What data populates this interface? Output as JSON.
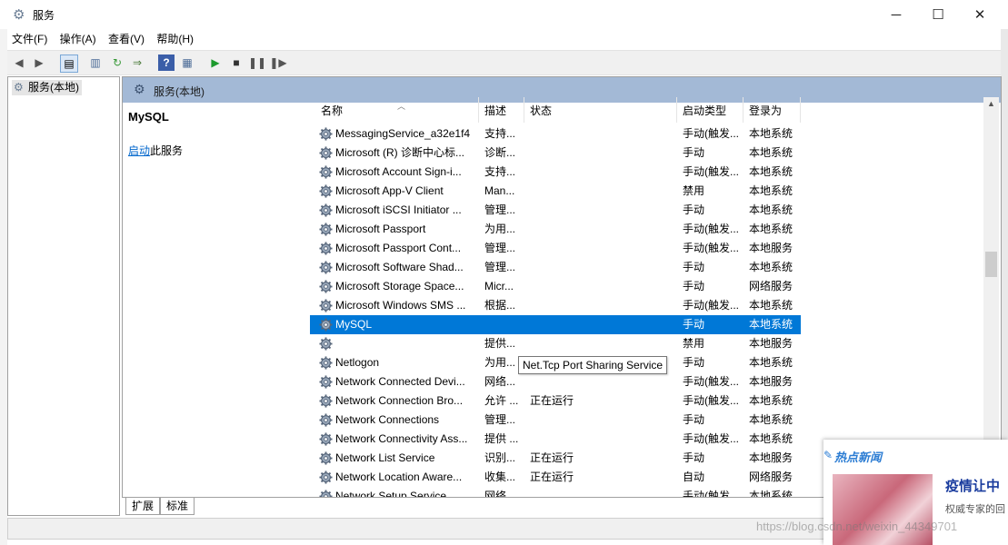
{
  "window": {
    "title": "服务",
    "controls": {
      "minimize": "─",
      "maximize": "☐",
      "close": "✕"
    }
  },
  "menu": [
    "文件(F)",
    "操作(A)",
    "查看(V)",
    "帮助(H)"
  ],
  "tree": {
    "item": "服务(本地)"
  },
  "pane": {
    "header": "服务(本地)"
  },
  "detail": {
    "service_name": "MySQL",
    "start_link": "启动",
    "start_suffix": "此服务"
  },
  "columns": {
    "name": "名称",
    "desc": "描述",
    "status": "状态",
    "start_type": "启动类型",
    "logon": "登录为"
  },
  "rows": [
    {
      "name": "MessagingService_a32e1f4",
      "desc": "支持...",
      "status": "",
      "start": "手动(触发...",
      "logon": "本地系统"
    },
    {
      "name": "Microsoft (R) 诊断中心标...",
      "desc": "诊断...",
      "status": "",
      "start": "手动",
      "logon": "本地系统"
    },
    {
      "name": "Microsoft Account Sign-i...",
      "desc": "支持...",
      "status": "",
      "start": "手动(触发...",
      "logon": "本地系统"
    },
    {
      "name": "Microsoft App-V Client",
      "desc": "Man...",
      "status": "",
      "start": "禁用",
      "logon": "本地系统"
    },
    {
      "name": "Microsoft iSCSI Initiator ...",
      "desc": "管理...",
      "status": "",
      "start": "手动",
      "logon": "本地系统"
    },
    {
      "name": "Microsoft Passport",
      "desc": "为用...",
      "status": "",
      "start": "手动(触发...",
      "logon": "本地系统"
    },
    {
      "name": "Microsoft Passport Cont...",
      "desc": "管理...",
      "status": "",
      "start": "手动(触发...",
      "logon": "本地服务"
    },
    {
      "name": "Microsoft Software Shad...",
      "desc": "管理...",
      "status": "",
      "start": "手动",
      "logon": "本地系统"
    },
    {
      "name": "Microsoft Storage Space...",
      "desc": "Micr...",
      "status": "",
      "start": "手动",
      "logon": "网络服务"
    },
    {
      "name": "Microsoft Windows SMS ...",
      "desc": "根据...",
      "status": "",
      "start": "手动(触发...",
      "logon": "本地系统"
    },
    {
      "name": "MySQL",
      "desc": "",
      "status": "",
      "start": "手动",
      "logon": "本地系统",
      "selected": true
    },
    {
      "name": "",
      "desc": "提供...",
      "status": "",
      "start": "禁用",
      "logon": "本地服务"
    },
    {
      "name": "Netlogon",
      "desc": "为用...",
      "status": "",
      "start": "手动",
      "logon": "本地系统"
    },
    {
      "name": "Network Connected Devi...",
      "desc": "网络...",
      "status": "",
      "start": "手动(触发...",
      "logon": "本地服务"
    },
    {
      "name": "Network Connection Bro...",
      "desc": "允许 ...",
      "status": "正在运行",
      "start": "手动(触发...",
      "logon": "本地系统"
    },
    {
      "name": "Network Connections",
      "desc": "管理...",
      "status": "",
      "start": "手动",
      "logon": "本地系统"
    },
    {
      "name": "Network Connectivity Ass...",
      "desc": "提供 ...",
      "status": "",
      "start": "手动(触发...",
      "logon": "本地系统"
    },
    {
      "name": "Network List Service",
      "desc": "识别...",
      "status": "正在运行",
      "start": "手动",
      "logon": "本地服务"
    },
    {
      "name": "Network Location Aware...",
      "desc": "收集...",
      "status": "正在运行",
      "start": "自动",
      "logon": "网络服务"
    },
    {
      "name": "Network Setup Service",
      "desc": "网络...",
      "status": "",
      "start": "手动(触发...",
      "logon": "本地系统"
    }
  ],
  "tooltip": "Net.Tcp Port Sharing Service",
  "tabs": [
    "扩展",
    "标准"
  ],
  "news": {
    "title": "热点新闻",
    "headline": "疫情让中",
    "subtitle": "权威专家的回"
  },
  "watermark": "https://blog.csdn.net/weixin_44349701",
  "colors": {
    "selection": "#0078d7",
    "pane_header": "#a3b9d6",
    "link": "#0066cc"
  }
}
